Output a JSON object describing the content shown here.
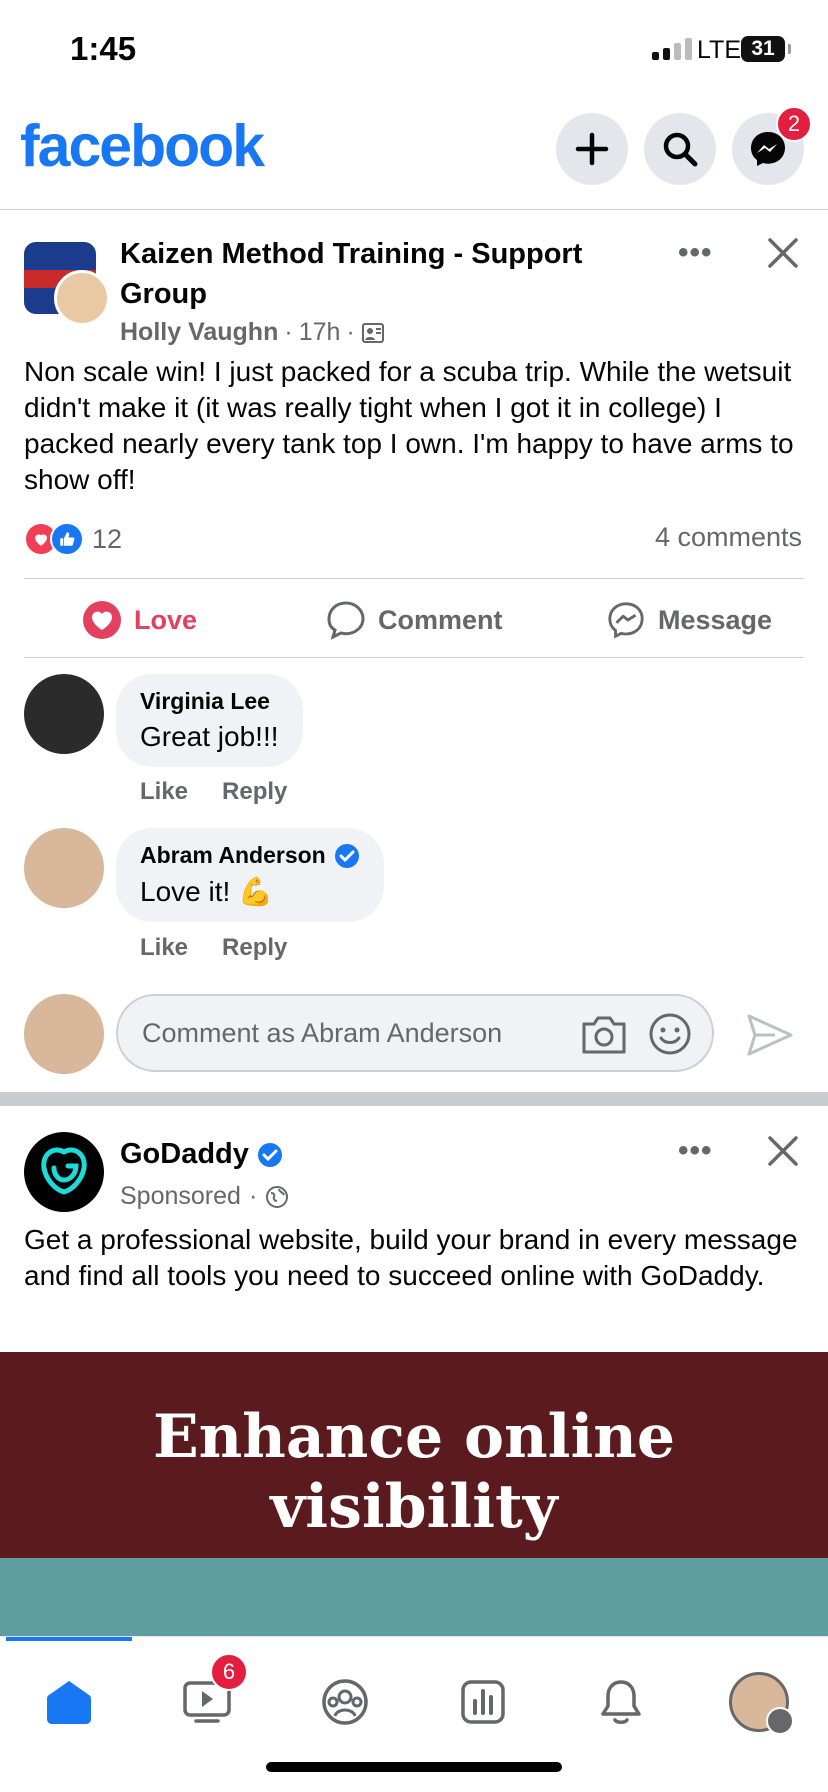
{
  "status_bar": {
    "time": "1:45",
    "network": "LTE",
    "battery": "31"
  },
  "header": {
    "logo": "facebook",
    "messenger_badge": "2",
    "icons": [
      "plus-icon",
      "search-icon",
      "messenger-icon"
    ]
  },
  "post1": {
    "group_name": "Kaizen Method Training - Support Group",
    "author": "Holly Vaughn",
    "time": "17h",
    "separator": "·",
    "text": "Non scale win! I just packed for a scuba trip. While the wetsuit didn't make it (it was really tight when I got it in college) I packed nearly every tank top I own. I'm happy to have arms to show off!",
    "reaction_count": "12",
    "comments_count": "4 comments",
    "actions": {
      "love": "Love",
      "comment": "Comment",
      "message": "Message"
    },
    "comments": [
      {
        "name": "Virginia Lee",
        "text": "Great job!!!",
        "like": "Like",
        "reply": "Reply"
      },
      {
        "name": "Abram Anderson",
        "text": "Love it! 💪",
        "like": "Like",
        "reply": "Reply"
      }
    ],
    "comment_input_placeholder": "Comment as Abram Anderson"
  },
  "post2": {
    "page_name": "GoDaddy",
    "sponsored": "Sponsored",
    "separator": "·",
    "text": "Get a professional website, build your brand in every message and find all tools you need to succeed online with GoDaddy.",
    "ad_headline": "Enhance online visibility"
  },
  "bottom_nav": {
    "video_badge": "6",
    "items": [
      "home-icon",
      "video-icon",
      "groups-icon",
      "dashboard-icon",
      "bell-icon",
      "profile-menu-icon"
    ]
  },
  "colors": {
    "brand": "#1877f2",
    "love": "#e4405f",
    "badge": "#e41e3f",
    "ad_bg": "#5b1a1d",
    "ad_teal": "#5f9ea0"
  }
}
